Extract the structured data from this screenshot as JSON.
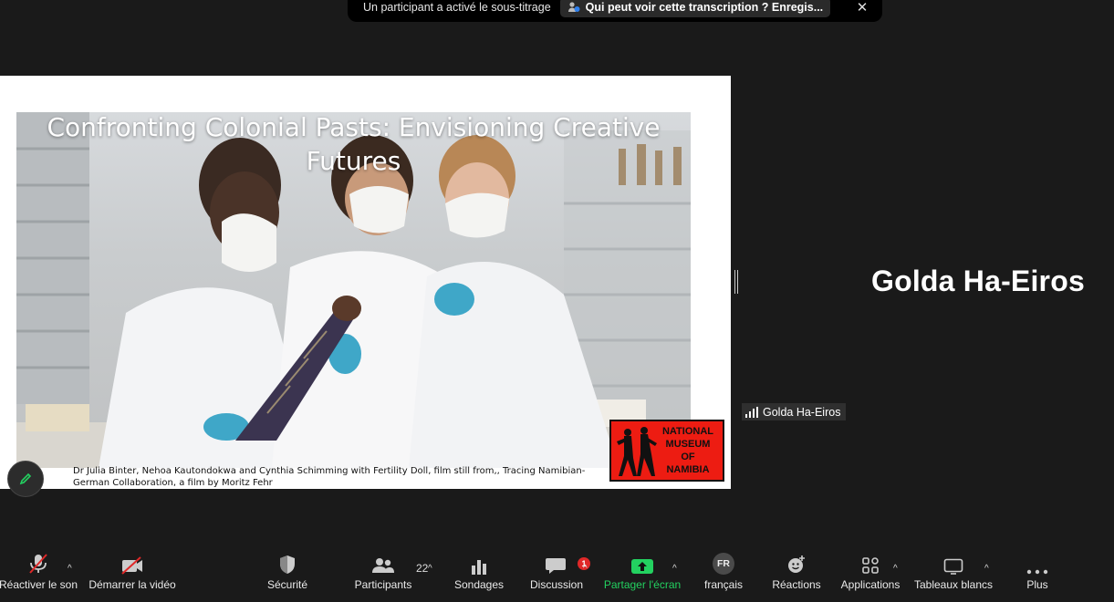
{
  "notification": {
    "message": "Un participant a activé le sous-titrage",
    "link": "Qui peut voir cette transcription ? Enregis...",
    "close_icon": "✕"
  },
  "share": {
    "slide_title": "Confronting Colonial Pasts: Envisioning Creative Futures",
    "caption": "Dr Julia Binter, Nehoa Kautondokwa and Cynthia Schimming with Fertility Doll, film still from,, Tracing Namibian-German Collaboration, a film by Moritz Fehr",
    "logo_lines": [
      "NATIONAL",
      "MUSEUM",
      "OF",
      "NAMIBIA"
    ]
  },
  "speaker": {
    "name": "Golda Ha-Eiros",
    "tag_name": "Golda Ha-Eiros"
  },
  "toolbar": {
    "unmute": "Réactiver le son",
    "start_video": "Démarrer la vidéo",
    "security": "Sécurité",
    "participants": "Participants",
    "participants_count": "22",
    "polls": "Sondages",
    "chat": "Discussion",
    "chat_badge": "1",
    "share_screen": "Partager l'écran",
    "language_code": "FR",
    "language": "français",
    "reactions": "Réactions",
    "apps": "Applications",
    "whiteboards": "Tableaux blancs",
    "more": "Plus"
  },
  "colors": {
    "accent_green": "#23d160",
    "badge_red": "#e02828",
    "logo_red": "#ed1c12"
  }
}
